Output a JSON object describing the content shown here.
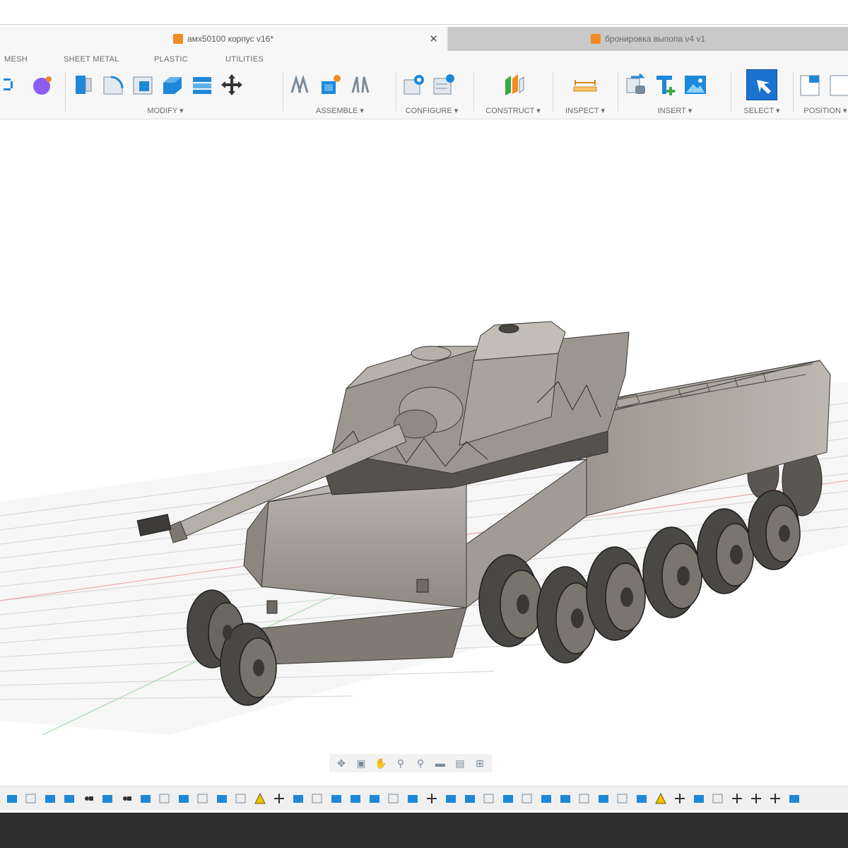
{
  "window": {
    "active_tab": "амх50100 корпус v16*",
    "inactive_tab": "бронировка выпопа v4 v1",
    "close_glyph": "✕"
  },
  "ribbon": {
    "tabs": [
      "MESH",
      "SHEET METAL",
      "PLASTIC",
      "UTILITIES"
    ],
    "groups": [
      {
        "label": "MODIFY ▾"
      },
      {
        "label": "ASSEMBLE ▾"
      },
      {
        "label": "CONFIGURE ▾"
      },
      {
        "label": "CONSTRUCT ▾"
      },
      {
        "label": "INSPECT ▾"
      },
      {
        "label": "INSERT ▾"
      },
      {
        "label": "SELECT ▾"
      },
      {
        "label": "POSITION ▾"
      }
    ]
  },
  "colors": {
    "accent_blue": "#1e88d8",
    "select_blue": "#1a73d1",
    "orange": "#f08a24",
    "purple": "#8b5cf6",
    "green": "#3aa845",
    "tank_body": "#a8a39b",
    "tank_dark": "#4a4845"
  },
  "navigation_bar": {
    "icons": [
      "orbit-icon",
      "look-at-icon",
      "pan-icon",
      "zoom-icon",
      "fit-icon",
      "display-icon",
      "grid-icon",
      "viewports-icon"
    ]
  },
  "timeline": {
    "icons": [
      "timeline-feature-icon",
      "timeline-sketch-icon",
      "timeline-warning-icon",
      "timeline-move-icon"
    ]
  }
}
